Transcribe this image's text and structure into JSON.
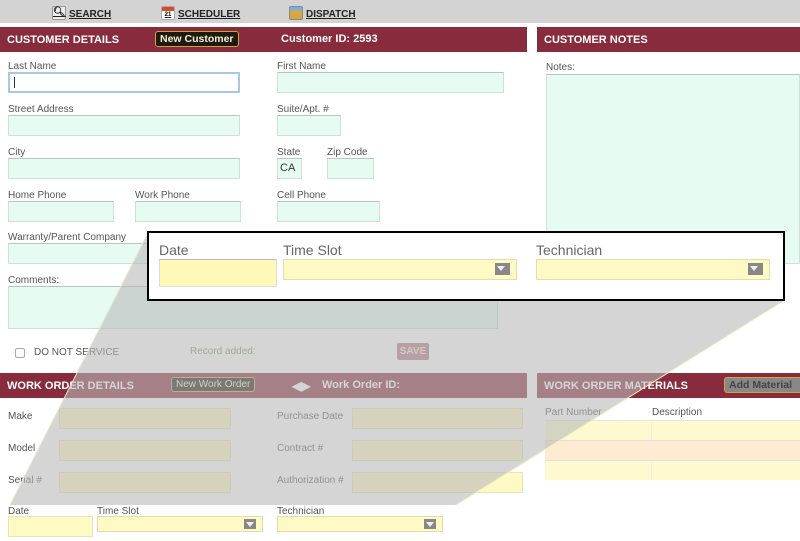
{
  "nav": {
    "items": [
      {
        "label": "SEARCH",
        "icon": "magnifier-icon"
      },
      {
        "label": "SCHEDULER",
        "icon": "calendar-icon",
        "badge": "21"
      },
      {
        "label": "DISPATCH",
        "icon": "clipboard-icon"
      }
    ]
  },
  "customer": {
    "title": "CUSTOMER DETAILS",
    "new_button": "New Customer",
    "id_label": "Customer ID: 2593",
    "fields": {
      "last_name": "Last Name",
      "first_name": "First Name",
      "street": "Street Address",
      "suite": "Suite/Apt. #",
      "city": "City",
      "state": "State",
      "state_value": "CA",
      "zip": "Zip Code",
      "home_phone": "Home Phone",
      "work_phone": "Work Phone",
      "cell_phone": "Cell Phone",
      "warranty": "Warranty/Parent Company",
      "comments": "Comments:"
    },
    "do_not_service": "DO NOT SERVICE",
    "status": "Record added:",
    "save": "SAVE"
  },
  "notes": {
    "title": "CUSTOMER NOTES",
    "label": "Notes:"
  },
  "work_order": {
    "title": "WORK ORDER DETAILS",
    "new_button": "New Work Order",
    "id_label": "Work Order ID:",
    "fields": {
      "make": "Make",
      "purchase_date": "Purchase Date",
      "model": "Model",
      "contract": "Contract #",
      "serial": "Serial #",
      "authorization": "Authorization #",
      "date": "Date",
      "time_slot": "Time Slot",
      "technician": "Technician"
    }
  },
  "materials": {
    "title": "WORK ORDER MATERIALS",
    "add_button": "Add Material",
    "columns": [
      "Part Number",
      "Description"
    ]
  },
  "callout": {
    "date": "Date",
    "time_slot": "Time Slot",
    "technician": "Technician"
  },
  "colors": {
    "header": "#872b3d",
    "input": "#e6fcf2",
    "input_yellow": "#fff9c4"
  }
}
